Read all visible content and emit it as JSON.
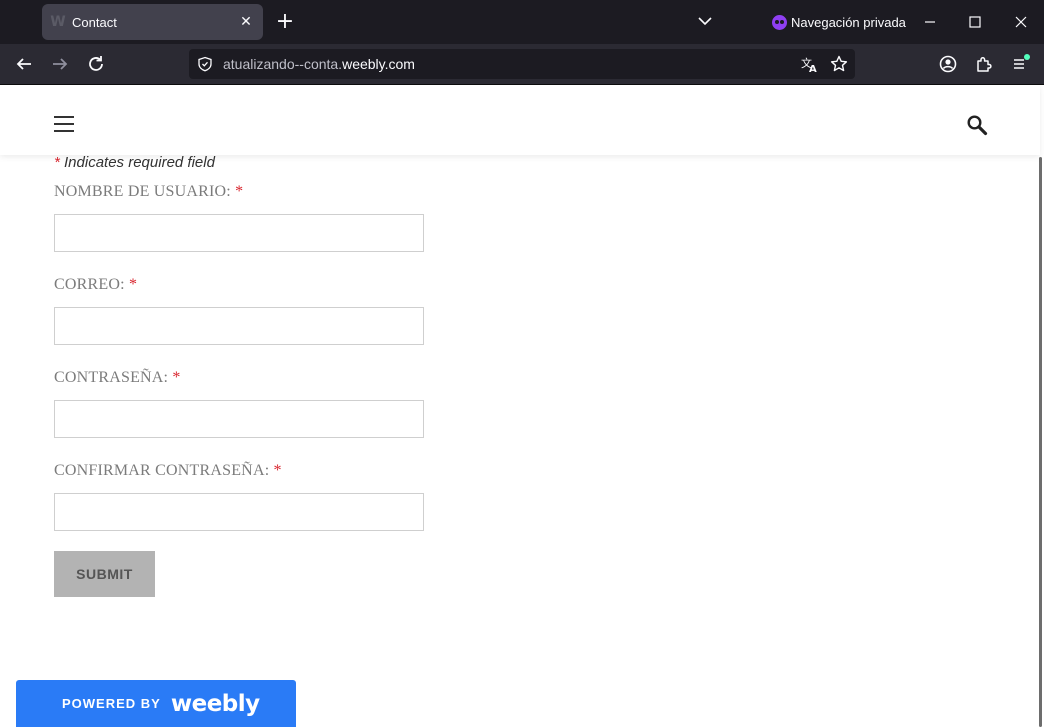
{
  "browser": {
    "tab": {
      "title": "Contact"
    },
    "private_label": "Navegación privada",
    "url": {
      "subdomain": "atualizando--conta.",
      "domain": "weebly.com"
    }
  },
  "form": {
    "required_star": "*",
    "required_note": " Indicates required field",
    "fields": [
      {
        "label": "NOMBRE DE USUARIO:",
        "value": ""
      },
      {
        "label": "CORREO:",
        "value": ""
      },
      {
        "label": "CONTRASEÑA:",
        "value": ""
      },
      {
        "label": "CONFIRMAR CONTRASEÑA:",
        "value": ""
      }
    ],
    "submit_label": "SUBMIT"
  },
  "badge": {
    "powered": "POWERED BY",
    "brand": "weebly"
  },
  "icons": {
    "favicon": "weebly-favicon-icon",
    "close": "close-icon",
    "new_tab": "plus-icon",
    "private": "private-mask-icon",
    "site_menu": "hamburger-icon",
    "site_search": "search-icon"
  },
  "colors": {
    "accent_blue": "#2a7bf6",
    "required_red": "#d9262f",
    "submit_bg": "#b3b3b3",
    "private_purple": "#8f3ff2"
  }
}
